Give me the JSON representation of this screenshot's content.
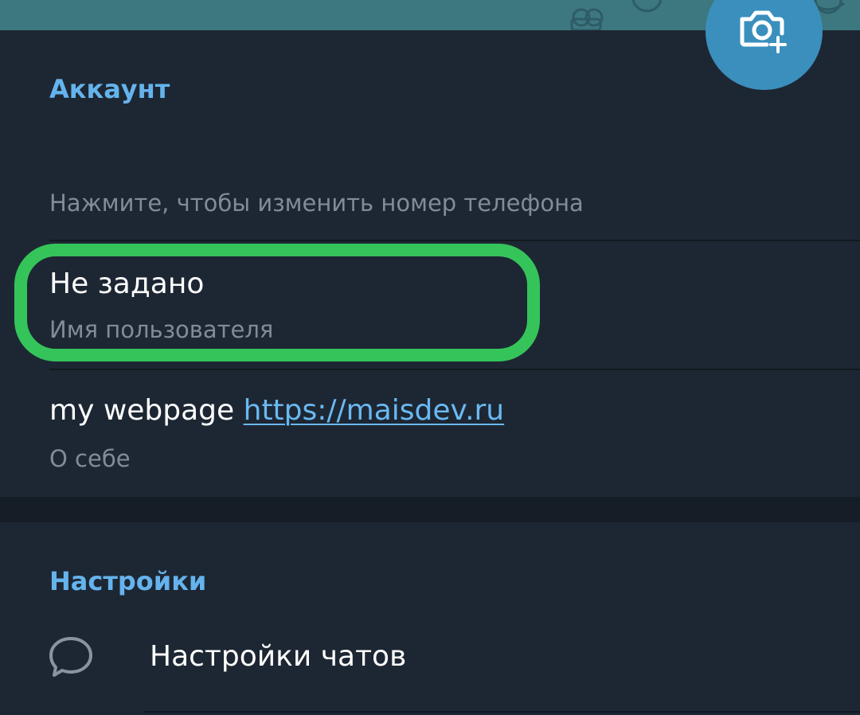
{
  "header": {
    "add_photo_icon": "camera-plus-icon"
  },
  "account": {
    "title": "Аккаунт",
    "phone_hint": "Нажмите, чтобы изменить номер телефона",
    "username": {
      "value": "Не задано",
      "label": "Имя пользователя"
    },
    "bio": {
      "text": "my webpage",
      "link": "https://maisdev.ru",
      "label": "О себе"
    }
  },
  "settings": {
    "title": "Настройки",
    "items": [
      {
        "label": "Настройки чатов",
        "icon": "chat-bubble-icon"
      }
    ]
  },
  "colors": {
    "accent": "#65b3ed",
    "background": "#1d2733",
    "highlight": "#35c45a",
    "fab": "#3a8fbd"
  }
}
